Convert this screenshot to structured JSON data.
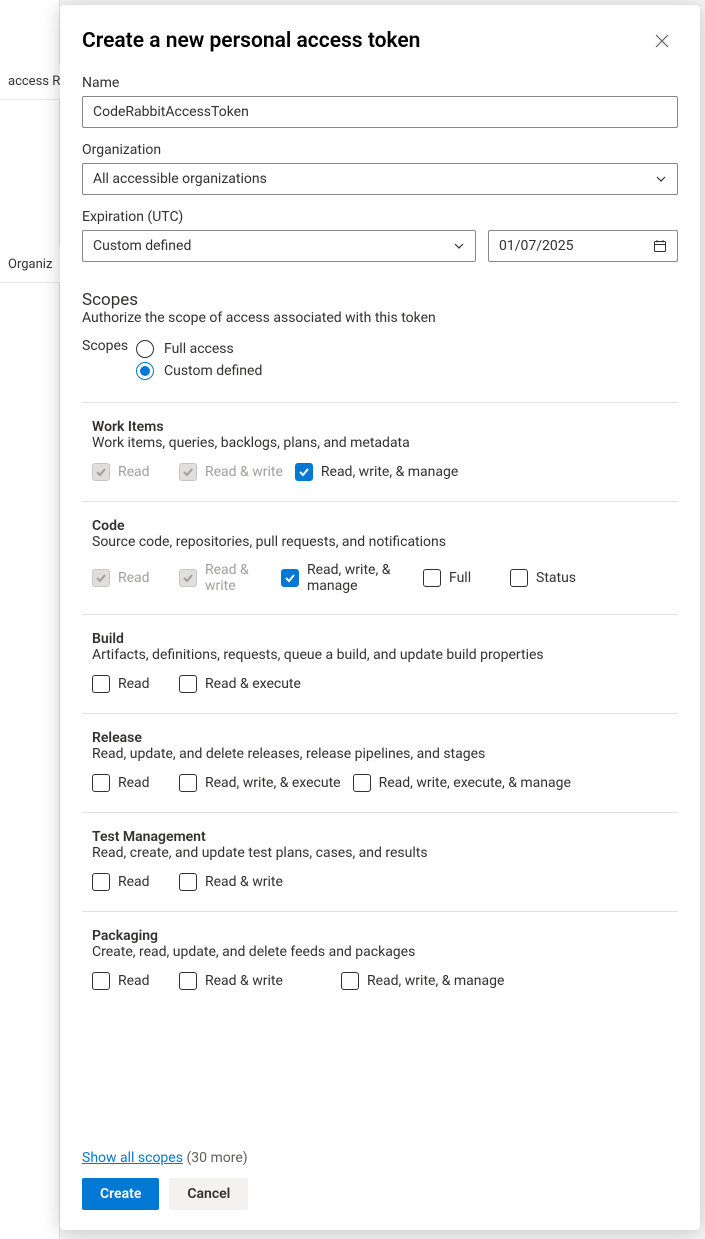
{
  "backdrop": {
    "row1": "access RI",
    "row2": "Organiz"
  },
  "modal": {
    "title": "Create a new personal access token",
    "name_label": "Name",
    "name_value": "CodeRabbitAccessToken",
    "org_label": "Organization",
    "org_value": "All accessible organizations",
    "expiration_label": "Expiration (UTC)",
    "expiration_select_value": "Custom defined",
    "expiration_date_value": "01/07/2025",
    "scopes_heading": "Scopes",
    "scopes_sub": "Authorize the scope of access associated with this token",
    "scopes_radio_label": "Scopes",
    "radio_full": "Full access",
    "radio_custom": "Custom defined",
    "scope_groups": {
      "work_items": {
        "title": "Work Items",
        "desc": "Work items, queries, backlogs, plans, and metadata",
        "opt_read": "Read",
        "opt_rw": "Read & write",
        "opt_rwm": "Read, write, & manage"
      },
      "code": {
        "title": "Code",
        "desc": "Source code, repositories, pull requests, and notifications",
        "opt_read": "Read",
        "opt_rw": "Read & write",
        "opt_rwm": "Read, write, & manage",
        "opt_full": "Full",
        "opt_status": "Status"
      },
      "build": {
        "title": "Build",
        "desc": "Artifacts, definitions, requests, queue a build, and update build properties",
        "opt_read": "Read",
        "opt_re": "Read & execute"
      },
      "release": {
        "title": "Release",
        "desc": "Read, update, and delete releases, release pipelines, and stages",
        "opt_read": "Read",
        "opt_rwe": "Read, write, & execute",
        "opt_rwem": "Read, write, execute, & manage"
      },
      "test": {
        "title": "Test Management",
        "desc": "Read, create, and update test plans, cases, and results",
        "opt_read": "Read",
        "opt_rw": "Read & write"
      },
      "packaging": {
        "title": "Packaging",
        "desc": "Create, read, update, and delete feeds and packages",
        "opt_read": "Read",
        "opt_rw": "Read & write",
        "opt_rwm": "Read, write, & manage"
      }
    },
    "show_all_link": "Show all scopes",
    "show_all_count": "(30 more)",
    "create_button": "Create",
    "cancel_button": "Cancel"
  }
}
